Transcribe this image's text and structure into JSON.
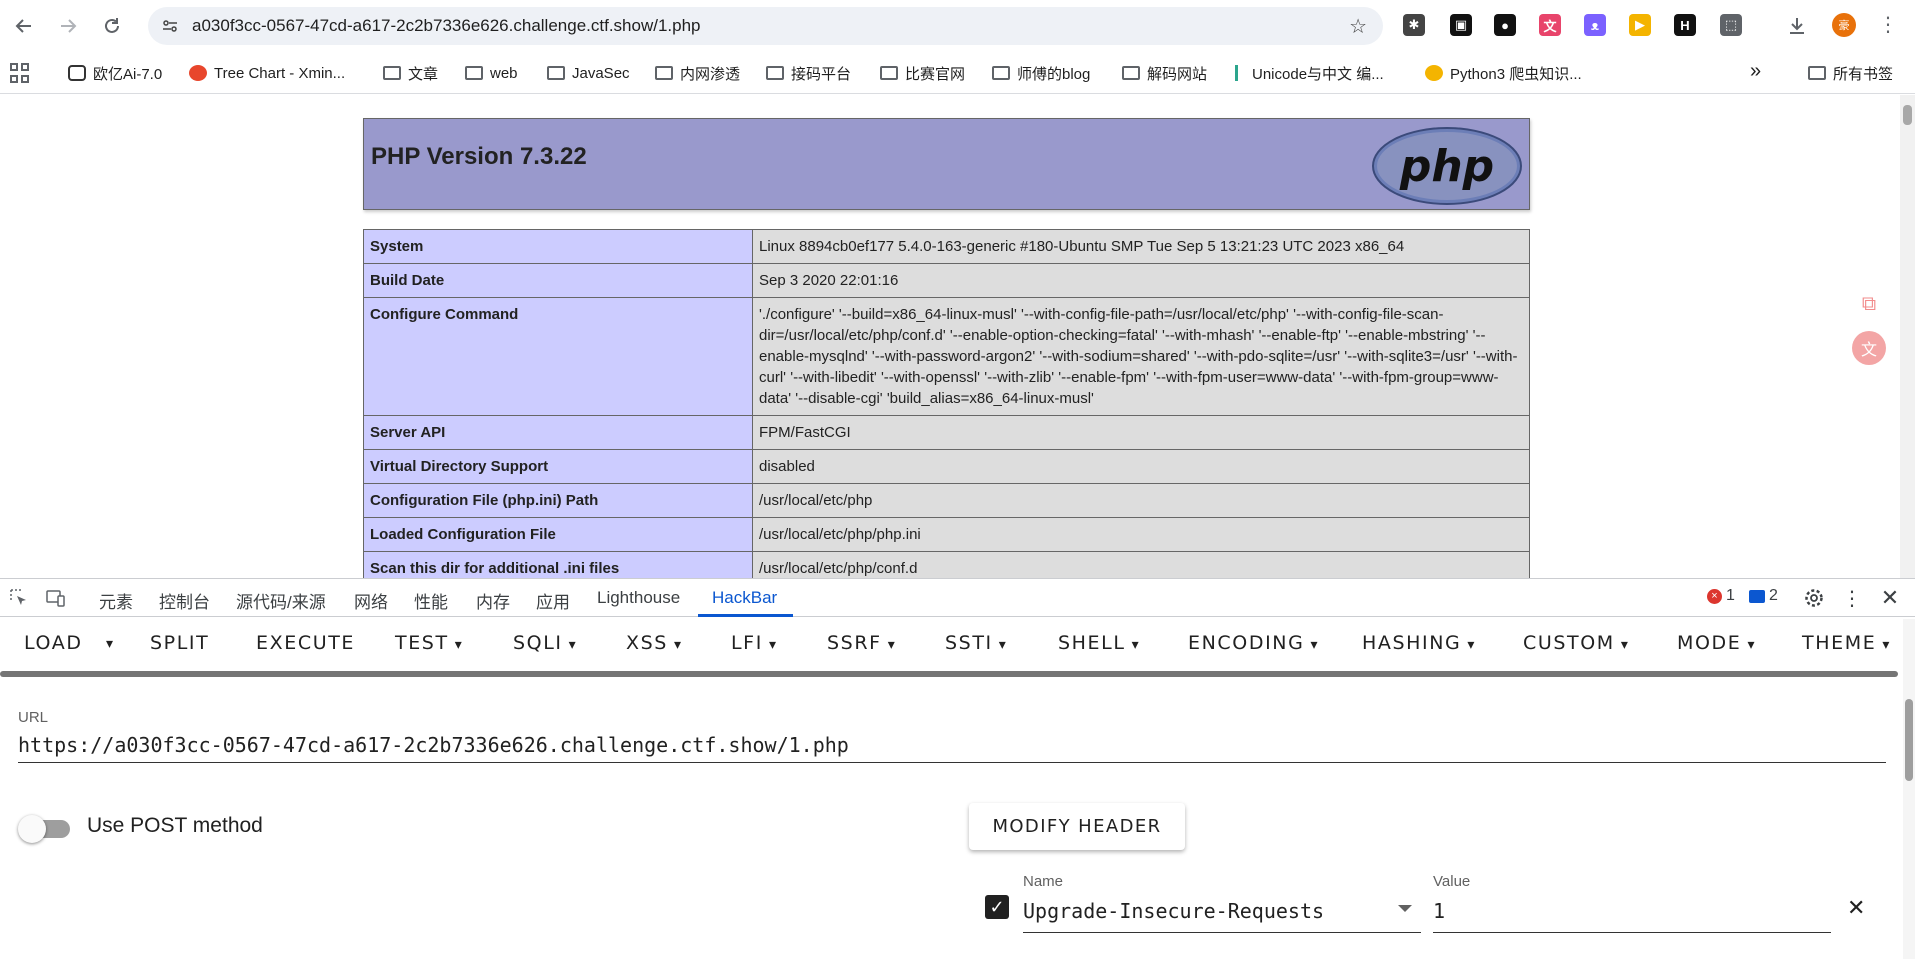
{
  "browser": {
    "url": "a030f3cc-0567-47cd-a617-2c2b7336e626.challenge.ctf.show/1.php",
    "avatar_text": "豪",
    "extensions": [
      {
        "icon": "bug-icon",
        "text": "✱",
        "color": "#444444"
      },
      {
        "icon": "game-controller-icon",
        "text": "▣",
        "color": "#111111"
      },
      {
        "icon": "record-icon",
        "text": "●",
        "color": "#111111"
      },
      {
        "icon": "translate-icon",
        "text": "文",
        "color": "#e8446b"
      },
      {
        "icon": "cat-icon",
        "text": "ᴥ",
        "color": "#7b61ff"
      },
      {
        "icon": "pointer-icon",
        "text": "▶",
        "color": "#f4b400"
      },
      {
        "icon": "h-letter-icon",
        "text": "H",
        "color": "#111111"
      },
      {
        "icon": "puzzle-icon",
        "text": "⬚",
        "color": "#5f6368"
      }
    ]
  },
  "bookmarks": {
    "items": [
      {
        "label": "欧亿Ai-7.0",
        "icon": "chat-icon"
      },
      {
        "label": "Tree Chart - Xmin...",
        "icon": "tree-chart-icon"
      },
      {
        "label": "文章",
        "icon": "folder-icon"
      },
      {
        "label": "web",
        "icon": "folder-icon"
      },
      {
        "label": "JavaSec",
        "icon": "folder-icon"
      },
      {
        "label": "内网渗透",
        "icon": "folder-icon"
      },
      {
        "label": "接码平台",
        "icon": "folder-icon"
      },
      {
        "label": "比赛官网",
        "icon": "folder-icon"
      },
      {
        "label": "师傅的blog",
        "icon": "folder-icon"
      },
      {
        "label": "解码网站",
        "icon": "folder-icon"
      },
      {
        "label": "Unicode与中文 编...",
        "icon": "unicode-icon"
      },
      {
        "label": "Python3 爬虫知识...",
        "icon": "python-icon"
      }
    ],
    "more": "»",
    "all_bookmarks": "所有书签"
  },
  "phpinfo": {
    "version_title": "PHP Version 7.3.22",
    "logo_text": "php",
    "rows": [
      {
        "key": "System",
        "value": "Linux 8894cb0ef177 5.4.0-163-generic #180-Ubuntu SMP Tue Sep 5 13:21:23 UTC 2023 x86_64"
      },
      {
        "key": "Build Date",
        "value": "Sep 3 2020 22:01:16"
      },
      {
        "key": "Configure Command",
        "value": "'./configure' '--build=x86_64-linux-musl' '--with-config-file-path=/usr/local/etc/php' '--with-config-file-scan-dir=/usr/local/etc/php/conf.d' '--enable-option-checking=fatal' '--with-mhash' '--enable-ftp' '--enable-mbstring' '--enable-mysqlnd' '--with-password-argon2' '--with-sodium=shared' '--with-pdo-sqlite=/usr' '--with-sqlite3=/usr' '--with-curl' '--with-libedit' '--with-openssl' '--with-zlib' '--enable-fpm' '--with-fpm-user=www-data' '--with-fpm-group=www-data' '--disable-cgi' 'build_alias=x86_64-linux-musl'"
      },
      {
        "key": "Server API",
        "value": "FPM/FastCGI"
      },
      {
        "key": "Virtual Directory Support",
        "value": "disabled"
      },
      {
        "key": "Configuration File (php.ini) Path",
        "value": "/usr/local/etc/php"
      },
      {
        "key": "Loaded Configuration File",
        "value": "/usr/local/etc/php/php.ini"
      },
      {
        "key": "Scan this dir for additional .ini files",
        "value": "/usr/local/etc/php/conf.d"
      },
      {
        "key": "",
        "value": ""
      }
    ]
  },
  "devtools": {
    "tabs": [
      "元素",
      "控制台",
      "源代码/来源",
      "网络",
      "性能",
      "内存",
      "应用",
      "Lighthouse",
      "HackBar"
    ],
    "active_tab": "HackBar",
    "error_count": "1",
    "message_count": "2"
  },
  "hackbar": {
    "menu": [
      "LOAD",
      "SPLIT",
      "EXECUTE",
      "TEST",
      "SQLI",
      "XSS",
      "LFI",
      "SSRF",
      "SSTI",
      "SHELL",
      "ENCODING",
      "HASHING",
      "CUSTOM",
      "MODE",
      "THEME"
    ],
    "url_label": "URL",
    "url_value": "https://a030f3cc-0567-47cd-a617-2c2b7336e626.challenge.ctf.show/1.php",
    "post_label": "Use POST method",
    "post_enabled": false,
    "modify_header_label": "MODIFY HEADER",
    "header_name_label": "Name",
    "header_name_value": "Upgrade-Insecure-Requests",
    "header_value_label": "Value",
    "header_value_value": "1",
    "header_enabled": true
  }
}
